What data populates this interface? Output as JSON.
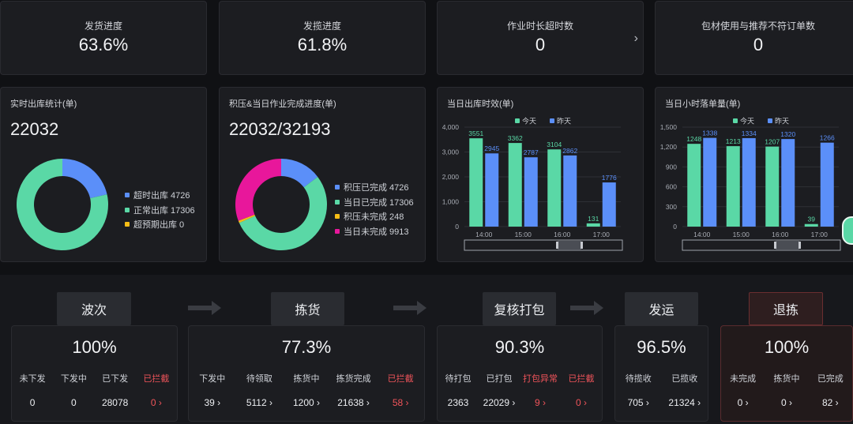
{
  "kpis": [
    {
      "label": "发货进度",
      "value": "63.6%"
    },
    {
      "label": "发揽进度",
      "value": "61.8%"
    },
    {
      "label": "作业时长超时数",
      "value": "0"
    },
    {
      "label": "包材使用与推荐不符订单数",
      "value": "0"
    }
  ],
  "outbound": {
    "title": "实时出库统计(单)",
    "total": "22032",
    "legend": [
      {
        "label": "超时出库 4726",
        "color": "#5b8ff9"
      },
      {
        "label": "正常出库 17306",
        "color": "#5ad8a6"
      },
      {
        "label": "超预期出库 0",
        "color": "#f6bd16"
      }
    ]
  },
  "backlog": {
    "title": "积压&当日作业完成进度(单)",
    "total": "22032/32193",
    "legend": [
      {
        "label": "积压已完成 4726",
        "color": "#5b8ff9"
      },
      {
        "label": "当日已完成 17306",
        "color": "#5ad8a6"
      },
      {
        "label": "积压未完成 248",
        "color": "#f6bd16"
      },
      {
        "label": "当日未完成 9913",
        "color": "#e8179b"
      }
    ]
  },
  "chart_data": [
    {
      "type": "pie",
      "title": "实时出库统计(单)",
      "labels": [
        "超时出库",
        "正常出库",
        "超预期出库"
      ],
      "values": [
        4726,
        17306,
        0
      ],
      "colors": [
        "#5b8ff9",
        "#5ad8a6",
        "#f6bd16"
      ]
    },
    {
      "type": "pie",
      "title": "积压&当日作业完成进度(单)",
      "labels": [
        "积压已完成",
        "当日已完成",
        "积压未完成",
        "当日未完成"
      ],
      "values": [
        4726,
        17306,
        248,
        9913
      ],
      "colors": [
        "#5b8ff9",
        "#5ad8a6",
        "#f6bd16",
        "#e8179b"
      ]
    },
    {
      "type": "bar",
      "title": "当日出库时效(单)",
      "categories": [
        "14:00",
        "15:00",
        "16:00",
        "17:00"
      ],
      "series": [
        {
          "name": "今天",
          "values": [
            3551,
            3362,
            3104,
            131
          ],
          "color": "#5ad8a6"
        },
        {
          "name": "昨天",
          "values": [
            2945,
            2787,
            2862,
            1776
          ],
          "color": "#5b8ff9"
        }
      ],
      "ylim": [
        0,
        4000
      ],
      "yticks": [
        "0",
        "1,000",
        "2,000",
        "3,000",
        "4,000"
      ],
      "ytick_values": [
        0,
        1000,
        2000,
        3000,
        4000
      ],
      "legend": "top-center"
    },
    {
      "type": "bar",
      "title": "当日小时落单量(单)",
      "categories": [
        "14:00",
        "15:00",
        "16:00",
        "17:00"
      ],
      "series": [
        {
          "name": "今天",
          "values": [
            1248,
            1213,
            1207,
            39
          ],
          "color": "#5ad8a6"
        },
        {
          "name": "昨天",
          "values": [
            1338,
            1334,
            1320,
            1266
          ],
          "color": "#5b8ff9"
        }
      ],
      "ylim": [
        0,
        1500
      ],
      "yticks": [
        "0",
        "300",
        "600",
        "900",
        "1,200",
        "1,500"
      ],
      "ytick_values": [
        0,
        300,
        600,
        900,
        1200,
        1500
      ],
      "legend": "top-center"
    }
  ],
  "stages": [
    {
      "name": "波次",
      "pct": "100%",
      "red": false,
      "cols": [
        {
          "label": "未下发",
          "value": "0"
        },
        {
          "label": "下发中",
          "value": "0"
        },
        {
          "label": "已下发",
          "value": "28078"
        },
        {
          "label": "已拦截",
          "value": "0 ›",
          "red": true
        }
      ]
    },
    {
      "name": "拣货",
      "pct": "77.3%",
      "red": false,
      "cols": [
        {
          "label": "下发中",
          "value": "39 ›"
        },
        {
          "label": "待领取",
          "value": "5112 ›"
        },
        {
          "label": "拣货中",
          "value": "1200 ›"
        },
        {
          "label": "拣货完成",
          "value": "21638 ›"
        },
        {
          "label": "已拦截",
          "value": "58 ›",
          "red": true
        }
      ]
    },
    {
      "name": "复核打包",
      "pct": "90.3%",
      "red": false,
      "cols": [
        {
          "label": "待打包",
          "value": "2363"
        },
        {
          "label": "已打包",
          "value": "22029 ›"
        },
        {
          "label": "打包异常",
          "value": "9 ›",
          "red": true
        },
        {
          "label": "已拦截",
          "value": "0 ›",
          "red": true
        }
      ]
    },
    {
      "name": "发运",
      "pct": "96.5%",
      "red": false,
      "cols": [
        {
          "label": "待揽收",
          "value": "705 ›"
        },
        {
          "label": "已揽收",
          "value": "21324 ›"
        }
      ]
    },
    {
      "name": "退拣",
      "pct": "100%",
      "red": true,
      "cols": [
        {
          "label": "未完成",
          "value": "0 ›"
        },
        {
          "label": "拣货中",
          "value": "0 ›"
        },
        {
          "label": "已完成",
          "value": "82 ›"
        }
      ]
    }
  ]
}
